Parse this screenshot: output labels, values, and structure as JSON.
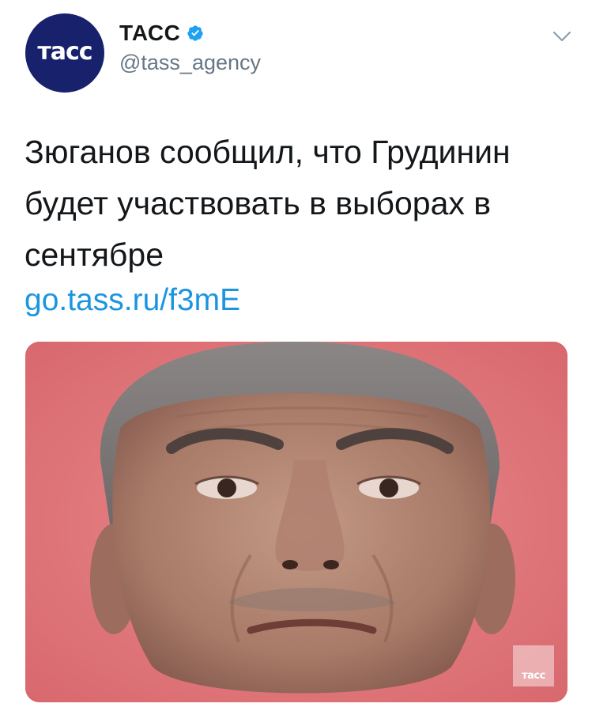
{
  "account": {
    "avatar_text": "тасс",
    "display_name": "ТАСС",
    "handle": "@tass_agency",
    "verified_icon": "verified-badge-icon"
  },
  "menu": {
    "icon": "chevron-down-icon"
  },
  "tweet": {
    "text": "Зюганов сообщил, что Грудинин будет участвовать в выборах в сентябре",
    "link": "go.tass.ru/f3mE"
  },
  "media": {
    "watermark_text": "тасс"
  },
  "colors": {
    "brand_navy": "#18216b",
    "link_blue": "#1b95e0",
    "verified_blue": "#1da1f2",
    "text_dark": "#14171a",
    "text_muted": "#657786",
    "photo_background": "#e07d81"
  }
}
